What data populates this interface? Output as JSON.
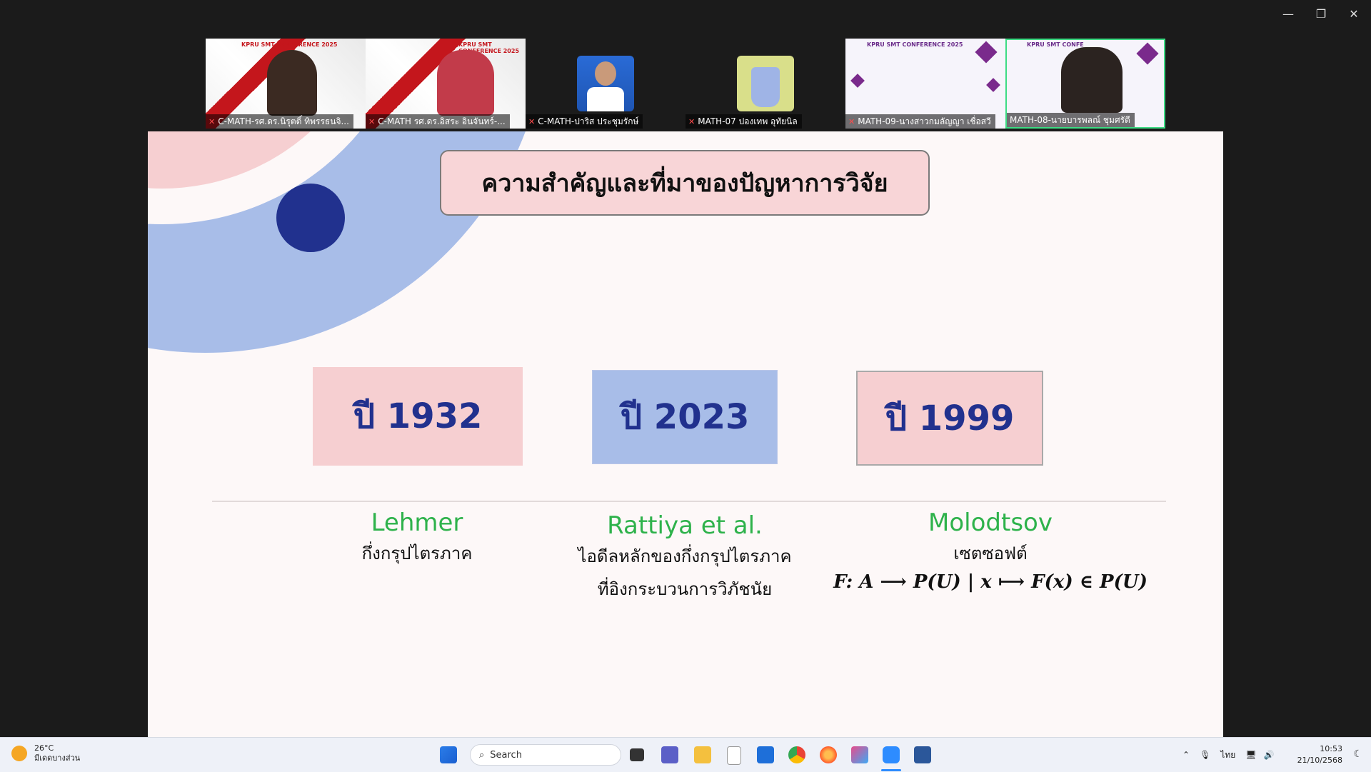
{
  "window": {
    "minimize_glyph": "—",
    "maximize_glyph": "❐",
    "close_glyph": "✕"
  },
  "participants": [
    {
      "name": "C-MATH-รศ.ดร.นิรุตติ์ ทิพรรธนจิ...",
      "banner": "KPRU SMT CONFERENCE 2025",
      "muted": true
    },
    {
      "name": "C-MATH รศ.ดร.อิสระ อินจันทร์-...",
      "banner": "KPRU SMT CONFERENCE 2025",
      "muted": true
    },
    {
      "name": "C-MATH-ปาริส ประชุมรักษ์",
      "muted": true
    },
    {
      "name": "MATH-07 ปองเทพ อุทัยนิล",
      "muted": true
    },
    {
      "name": "MATH-09-นางสาวกมลัญญา เชื่อสวี",
      "banner": "KPRU SMT CONFERENCE 2025",
      "muted": true
    },
    {
      "name": "MATH-08-นายบารพลณ์ ชุมศรัดี",
      "banner": "KPRU SMT CONFE",
      "muted": false
    }
  ],
  "slide": {
    "title": "ความสำคัญและที่มาของปัญหาการวิจัย",
    "years": [
      {
        "label": "ปี 1932",
        "color": "#f6cfd1"
      },
      {
        "label": "ปี 2023",
        "color": "#a8bde8"
      },
      {
        "label": "ปี 1999",
        "color": "#f6cfd1"
      }
    ],
    "columns": [
      {
        "name": "Lehmer",
        "lines": [
          "กึ่งกรุปไตรภาค"
        ]
      },
      {
        "name": "Rattiya et al.",
        "lines": [
          "ไอดีลหลักของกึ่งกรุปไตรภาค",
          "ที่อิงกระบวนการวิภัชนัย"
        ]
      },
      {
        "name": "Molodtsov",
        "lines": [
          "เซตซอฟต์"
        ],
        "formula": "F: A ⟶ P(U) | x ⟼ F(x) ∈ P(U)"
      }
    ]
  },
  "taskbar": {
    "weather_temp": "26°C",
    "weather_desc": "มีเดดบางส่วน",
    "search_label": "Search",
    "language": "ไทย",
    "time": "10:53",
    "date": "21/10/2568"
  }
}
